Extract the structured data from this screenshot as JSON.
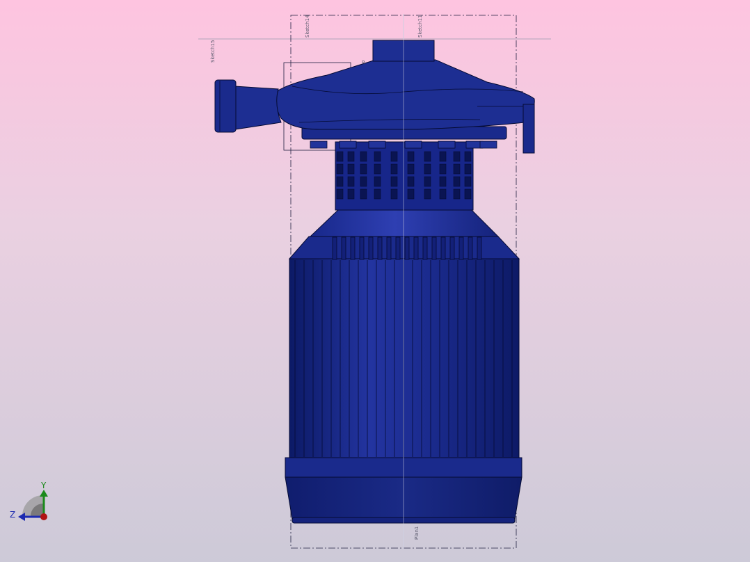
{
  "viewport": {
    "background_top": "#fec4e0",
    "background_bottom": "#cdcad8"
  },
  "model": {
    "color": "#1c2d8e",
    "shadow_color": "#131f6a",
    "edge_color": "#050b33"
  },
  "sketch_labels": {
    "top_left_a": "Sketch15",
    "top_left_b": "Sketch14",
    "top_center": "Sketch11",
    "bottom_center": "Plan1",
    "small_mark": "R"
  },
  "triad": {
    "y_label": "Y",
    "z_label": "Z",
    "y_color": "#1b8a1b",
    "z_color": "#1d2bb0",
    "x_color": "#b01414"
  }
}
